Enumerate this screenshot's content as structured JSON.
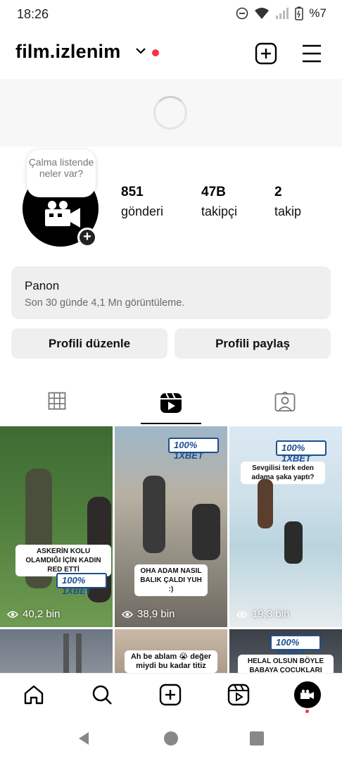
{
  "status_bar": {
    "time": "18:26",
    "battery": "%7"
  },
  "profile": {
    "username": "film.izlenim",
    "note": "Çalma listende neler var?",
    "stats": [
      {
        "value": "851",
        "label": "gönderi"
      },
      {
        "value": "47B",
        "label": "takipçi"
      },
      {
        "value": "2",
        "label": "takip"
      }
    ]
  },
  "dashboard": {
    "title": "Panon",
    "subtitle": "Son 30 günde 4,1 Mn görüntüleme."
  },
  "buttons": {
    "edit_profile": "Profili düzenle",
    "share_profile": "Profili paylaş"
  },
  "tabs": [
    "grid",
    "reels",
    "tagged"
  ],
  "reels": [
    {
      "caption": "ASKERİN KOLU OLAMDIĞI İÇİN KADIN RED ETTİ",
      "views": "40,2 bin"
    },
    {
      "caption": "OHA ADAM NASIL BALIK ÇALDI YUH :)",
      "views": "38,9 bin"
    },
    {
      "caption": "Sevgilisi terk eden adama şaka yaptı?",
      "views": "19,3 bin"
    },
    {
      "caption": "",
      "views": ""
    },
    {
      "caption": "Ah be ablam 😭 değer miydi bu kadar titiz",
      "views": ""
    },
    {
      "caption": "HELAL OLSUN BÖYLE BABAYA ÇOCUKLARI NASIL",
      "views": ""
    }
  ],
  "badge_text": "1XBET",
  "badge_prefix": "100%",
  "colors": {
    "accent_red": "#ff2d48",
    "button_bg": "#efefef",
    "badge_blue": "#1d4f91"
  }
}
